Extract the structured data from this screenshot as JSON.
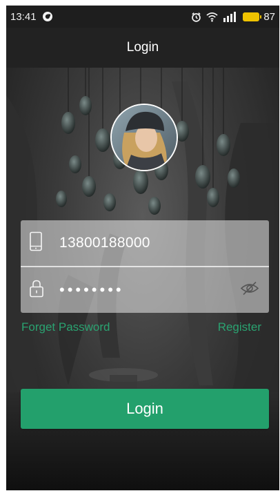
{
  "status_bar": {
    "time": "13:41",
    "battery_level": "87",
    "icons": [
      "app-notification-icon",
      "alarm-icon",
      "wifi-icon",
      "signal-icon",
      "battery-icon"
    ]
  },
  "header": {
    "title": "Login"
  },
  "avatar": {
    "icon": "user-avatar"
  },
  "form": {
    "phone_value": "13800188000",
    "password_mask": "••••••••",
    "phone_icon": "mobile-phone-icon",
    "lock_icon": "lock-icon",
    "visibility_icon": "eye-hidden-icon"
  },
  "links": {
    "forget_password": "Forget Password",
    "register": "Register"
  },
  "actions": {
    "login_label": "Login"
  },
  "colors": {
    "accent": "#23a06c",
    "link": "#2aa371",
    "battery": "#f0c300"
  }
}
